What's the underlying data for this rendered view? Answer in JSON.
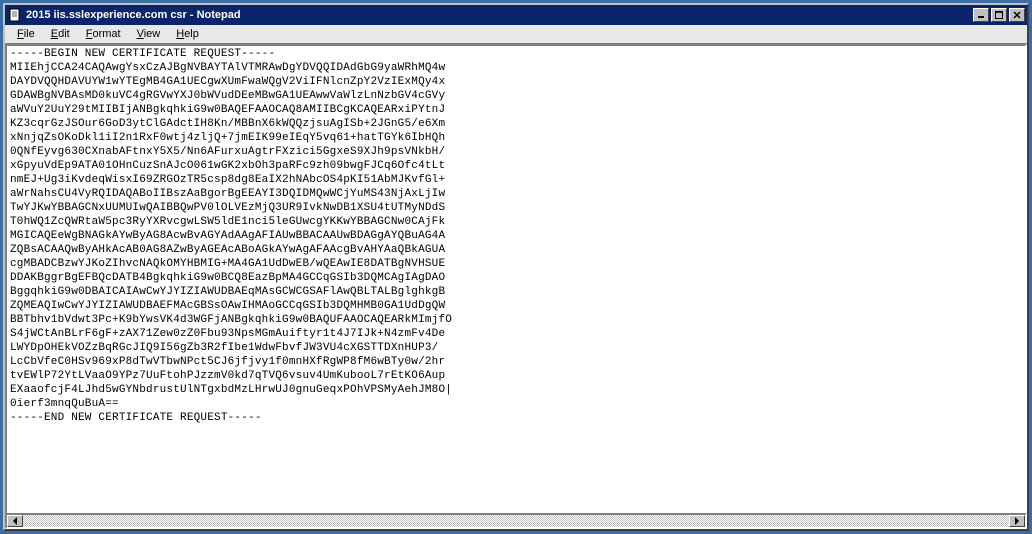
{
  "window": {
    "title": "2015 iis.sslexperience.com csr - Notepad"
  },
  "menu": {
    "file": "File",
    "edit": "Edit",
    "format": "Format",
    "view": "View",
    "help": "Help"
  },
  "content": "-----BEGIN NEW CERTIFICATE REQUEST-----\nMIIEhjCCA24CAQAwgYsxCzAJBgNVBAYTAlVTMRAwDgYDVQQIDAdGbG9yaWRhMQ4w\nDAYDVQQHDAVUYW1wYTEgMB4GA1UECgwXUmFwaWQgV2ViIFNlcnZpY2VzIExMQy4x\nGDAWBgNVBAsMD0kuVC4gRGVwYXJ0bWVudDEeMBwGA1UEAwwVaWlzLnNzbGV4cGVy\naWVuY2UuY29tMIIBIjANBgkqhkiG9w0BAQEFAAOCAQ8AMIIBCgKCAQEARxiPYtnJ\nKZ3cqrGzJSOur6GoD3ytClGAdctIH8Kn/MBBnX6kWQQzjsuAgISb+2JGnG5/e6Xm\nxNnjqZsOKoDkl1iI2n1RxF0wtj4zljQ+7jmEIK99eIEqY5vq61+hatTGYk6IbHQh\n0QNfEyvg630CXnabAFtnxY5X5/Nn6AFurxuAgtrFXzici5GgxeS9XJh9psVNkbH/\nxGpyuVdEp9ATA01OHnCuzSnAJcO061wGK2xbOh3paRFc9zh09bwgFJCq6Ofc4tLt\nnmEJ+Ug3iKvdeqWisxI69ZRGOzTR5csp8dg8EaIX2hNAbcOS4pKI51AbMJKvfGl+\naWrNahsCU4VyRQIDAQABoIIBszAaBgorBgEEAYI3DQIDMQwWCjYuMS43NjAxLjIw\nTwYJKwYBBAGCNxUUMUIwQAIBBQwPV0lOLVEzMjQ3UR9IvkNwDB1XSU4tUTMyNDdS\nT0hWQ1ZcQWRtaW5pc3RyYXRvcgwLSW5ldE1nci5leGUwcgYKKwYBBAGCNw0CAjFk\nMGICAQEeWgBNAGkAYwByAG8AcwBvAGYAdAAgAFIAUwBBACAAUwBDAGgAYQBuAG4A\nZQBsACAAQwByAHkAcAB0AG8AZwByAGEAcABoAGkAYwAgAFAAcgBvAHYAaQBkAGUA\ncgMBADCBzwYJKoZIhvcNAQkOMYHBMIG+MA4GA1UdDwEB/wQEAwIE8DATBgNVHSUE\nDDAKBggrBgEFBQcDATB4BgkqhkiG9w0BCQ8EazBpMA4GCCqGSIb3DQMCAgIAgDAO\nBggqhkiG9w0DBAICAIAwCwYJYIZIAWUDBAEqMAsGCWCGSAFlAwQBLTALBglghkgB\nZQMEAQIwCwYJYIZIAWUDBAEFMAcGBSsOAwIHMAoGCCqGSIb3DQMHMB0GA1UdDgQW\nBBTbhv1bVdwt3Pc+K9bYwsVK4d3WGFjANBgkqhkiG9w0BAQUFAAOCAQEARkMImjfO\nS4jWCtAnBLrF6gF+zAX71Zew0zZ0Fbu93NpsMGmAuiftyr1t4J7IJk+N4zmFv4De\nLWYDpOHEkVOZzBqRGcJIQ9I56gZb3R2fIbe1WdwFbvfJW3VU4cXGSTTDXnHUP3/\nLcCbVfeC0HSv969xP8dTwVTbwNPct5CJ6jfjvy1f0mnHXfRgWP8fM6wBTy0w/2hr\ntvEWlP72YtLVaaO9YPz7UuFtohPJzzmV0kd7qTVQ6vsuv4UmKubooL7rEtKO6Aup\nEXaaofcjF4LJhd5wGYNbdrustUlNTgxbdMzLHrwUJ0gnuGeqxPOhVPSMyAehJM8O|\n0ierf3mnqQuBuA==\n-----END NEW CERTIFICATE REQUEST-----"
}
